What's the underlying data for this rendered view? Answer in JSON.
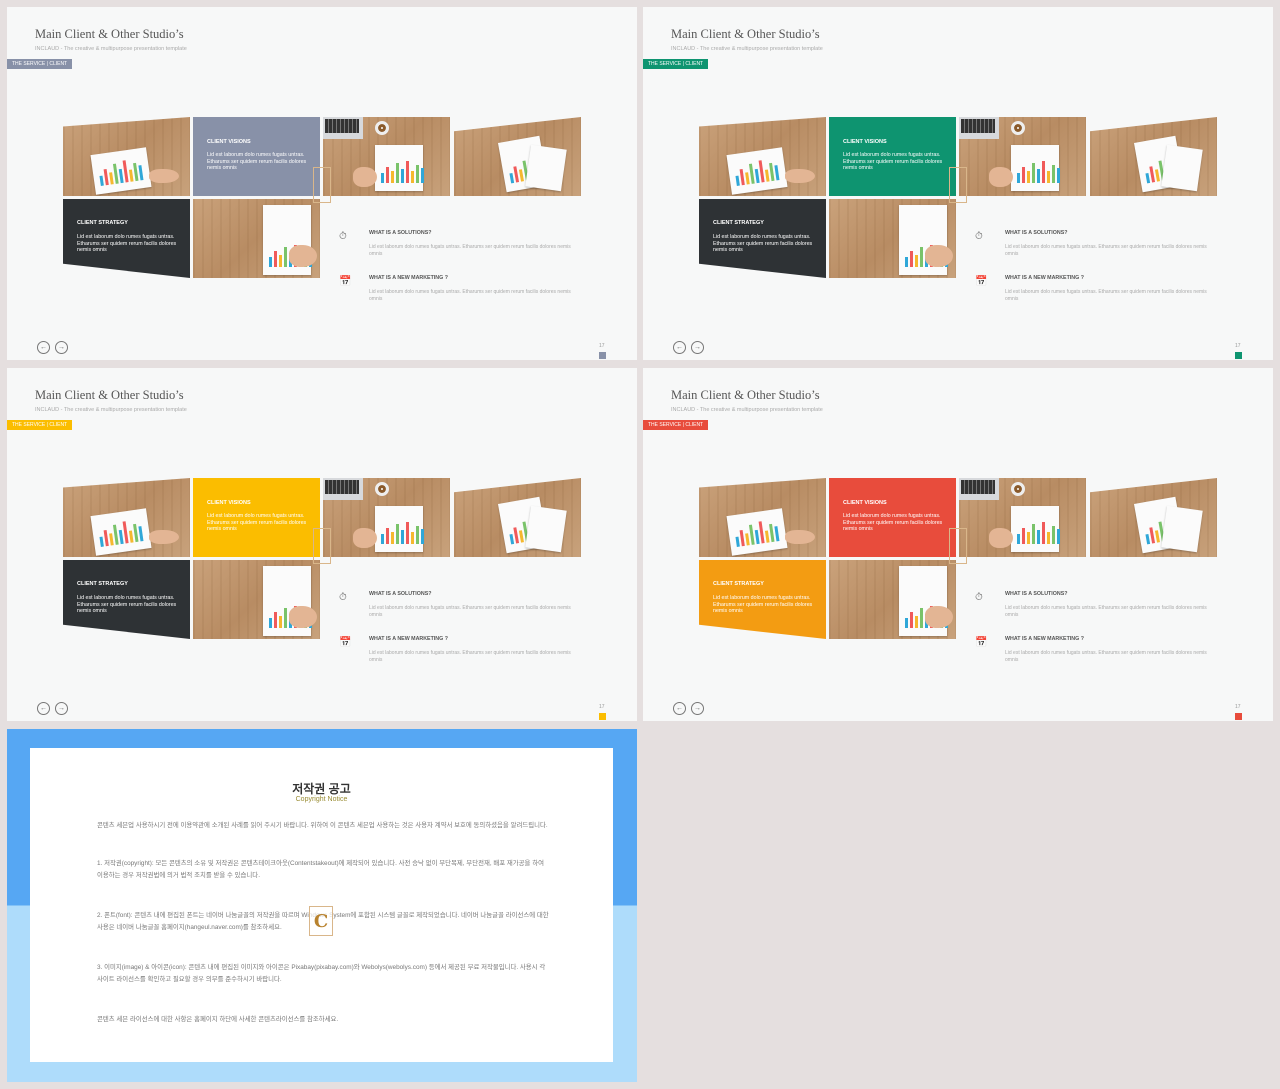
{
  "slides": [
    {
      "title": "Main Client & Other Studio’s",
      "subtitle": "INCLAUD - The creative & multipurpose presentation template",
      "tag": "THE SERVICE | CLIENT",
      "vision_title": "CLIENT VISIONS",
      "vision_text": "Lid est laborum dolo rumes fugats untras. Etharums ser quidem rerum facilis dolores nemis omnis",
      "strategy_title": "CLIENT STRATEGY",
      "strategy_text": "Lid est laborum dolo rumes fugats untras. Etharums ser quidem rerum facilis dolores nemis omnis",
      "q1_title": "WHAT IS A SOLUTIONS?",
      "q1_text": "Lid est laborum dolo rumes fugats untras. Etharums ser quidem rerum facilis dolores nemis omnis",
      "q2_title": "WHAT IS A NEW MARKETING ?",
      "q2_text": "Lid est laborum dolo rumes fugats untras. Etharums ser quidem rerum facilis dolores nemis omnis",
      "page": "17",
      "accent": "#8891a8",
      "strategy_color": "#2e3235"
    },
    {
      "title": "Main Client & Other Studio’s",
      "subtitle": "INCLAUD - The creative & multipurpose presentation template",
      "tag": "THE SERVICE | CLIENT",
      "vision_title": "CLIENT VISIONS",
      "vision_text": "Lid est laborum dolo rumes fugats untras. Etharums ser quidem rerum facilis dolores nemis omnis",
      "strategy_title": "CLIENT STRATEGY",
      "strategy_text": "Lid est laborum dolo rumes fugats untras. Etharums ser quidem rerum facilis dolores nemis omnis",
      "q1_title": "WHAT IS A SOLUTIONS?",
      "q1_text": "Lid est laborum dolo rumes fugats untras. Etharums ser quidem rerum facilis dolores nemis omnis",
      "q2_title": "WHAT IS A NEW MARKETING ?",
      "q2_text": "Lid est laborum dolo rumes fugats untras. Etharums ser quidem rerum facilis dolores nemis omnis",
      "page": "17",
      "accent": "#0e9470",
      "strategy_color": "#2e3235"
    },
    {
      "title": "Main Client & Other Studio’s",
      "subtitle": "INCLAUD - The creative & multipurpose presentation template",
      "tag": "THE SERVICE | CLIENT",
      "vision_title": "CLIENT VISIONS",
      "vision_text": "Lid est laborum dolo rumes fugats untras. Etharums ser quidem rerum facilis dolores nemis omnis",
      "strategy_title": "CLIENT STRATEGY",
      "strategy_text": "Lid est laborum dolo rumes fugats untras. Etharums ser quidem rerum facilis dolores nemis omnis",
      "q1_title": "WHAT IS A SOLUTIONS?",
      "q1_text": "Lid est laborum dolo rumes fugats untras. Etharums ser quidem rerum facilis dolores nemis omnis",
      "q2_title": "WHAT IS A NEW MARKETING ?",
      "q2_text": "Lid est laborum dolo rumes fugats untras. Etharums ser quidem rerum facilis dolores nemis omnis",
      "page": "17",
      "accent": "#fbbd00",
      "strategy_color": "#2e3235"
    },
    {
      "title": "Main Client & Other Studio’s",
      "subtitle": "INCLAUD - The creative & multipurpose presentation template",
      "tag": "THE SERVICE | CLIENT",
      "vision_title": "CLIENT VISIONS",
      "vision_text": "Lid est laborum dolo rumes fugats untras. Etharums ser quidem rerum facilis dolores nemis omnis",
      "strategy_title": "CLIENT STRATEGY",
      "strategy_text": "Lid est laborum dolo rumes fugats untras. Etharums ser quidem rerum facilis dolores nemis omnis",
      "q1_title": "WHAT IS A SOLUTIONS?",
      "q1_text": "Lid est laborum dolo rumes fugats untras. Etharums ser quidem rerum facilis dolores nemis omnis",
      "q2_title": "WHAT IS A NEW MARKETING ?",
      "q2_text": "Lid est laborum dolo rumes fugats untras. Etharums ser quidem rerum facilis dolores nemis omnis",
      "page": "17",
      "accent": "#e84c3c",
      "strategy_color": "#f39c12"
    }
  ],
  "icons": {
    "q1": "clock-icon",
    "q2": "calendar-icon",
    "prev": "arrow-left-circle-icon",
    "next": "arrow-right-circle-icon"
  },
  "copyright": {
    "title": "저작권 공고",
    "subtitle": "Copyright Notice",
    "p0": "콘텐츠 세븐업 사용하시기 전에 이용약관에 소개된 사례를 읽어 주시기 바랍니다. 위하여 이 콘텐츠 세븐업 사용하는 것은 사용자 계약서 보호에 동의하셨음을 알려드립니다.",
    "p1": "1. 저작권(copyright): 모든 콘텐츠의 소유 및 저작권은 콘텐츠테이크아웃(Contentstakeout)에 제작되어 있습니다. 사전 승낙 없이 무단복제, 무단전재, 배포 재가공을 하여 이용하는 경우 저작권법에 의거 법적 조치를 받을 수 있습니다.",
    "p2": "2. 폰트(font): 콘텐츠 내에 편집된 폰트는 네이버 나눔글꼴의 저작권을 따르며 Windows System에 포함된 시스템 글꼴로 제작되었습니다. 네이버 나눔글꼴 라이선스에 대한 사용은 네이버 나눔글꼴 홈페이지(hangeul.naver.com)를 참조하세요.",
    "p3": "3. 이미지(image) & 아이콘(icon): 콘텐츠 내에 편집된 이미지와 아이콘은 Pixabay(pixabay.com)와 Webolys(webolys.com) 등에서 제공된 무료 저작물입니다. 사용시 각 사이트 라이선스를 확인하고 필요할 경우 의무를 준수하시기 바랍니다.",
    "p4": "콘텐츠 세븐 라이선스에 대한 사항은 홈페이지 하단에 사세한 콘텐츠라이선스를 참조하세요.",
    "badge": "C"
  }
}
